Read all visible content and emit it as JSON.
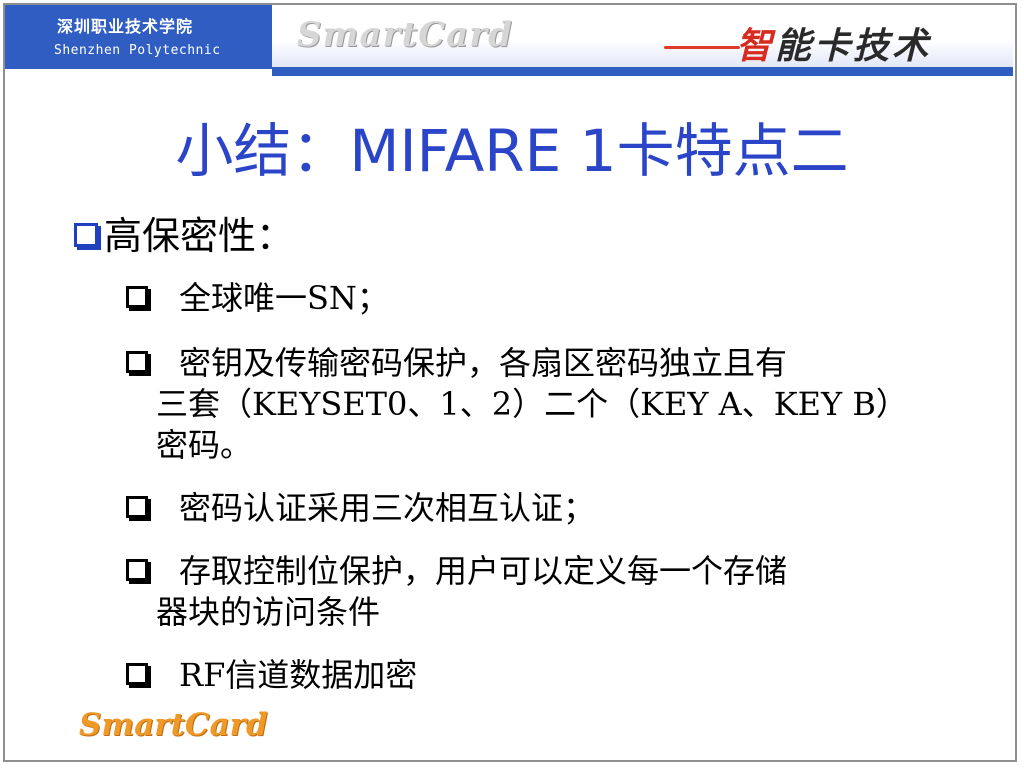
{
  "header": {
    "school_cn": "深圳职业技术学院",
    "school_en": "Shenzhen Polytechnic",
    "logo_en": "SmartCard",
    "logo_cn_first": "智",
    "logo_cn_rest": "能卡技术"
  },
  "colors": {
    "brand_blue": "#2f5dc2",
    "title_blue": "#2b45c8",
    "accent_red": "#e03a2a",
    "footer_orange": "#ef9a28"
  },
  "title": "小结：MIFARE 1卡特点二",
  "section": {
    "label": "高保密性："
  },
  "bullets": [
    {
      "line1": "全球唯一SN；",
      "line2": "",
      "line3": ""
    },
    {
      "line1": "密钥及传输密码保护，各扇区密码独立且有",
      "line2": "三套（KEYSET0、1、2）二个（KEY A、KEY B）",
      "line3": "密码。"
    },
    {
      "line1": "密码认证采用三次相互认证；",
      "line2": "",
      "line3": ""
    },
    {
      "line1": "存取控制位保护，用户可以定义每一个存储",
      "line2": "器块的访问条件",
      "line3": ""
    },
    {
      "line1": "RF信道数据加密",
      "line2": "",
      "line3": ""
    }
  ],
  "footer": {
    "logo": "SmartCard"
  }
}
